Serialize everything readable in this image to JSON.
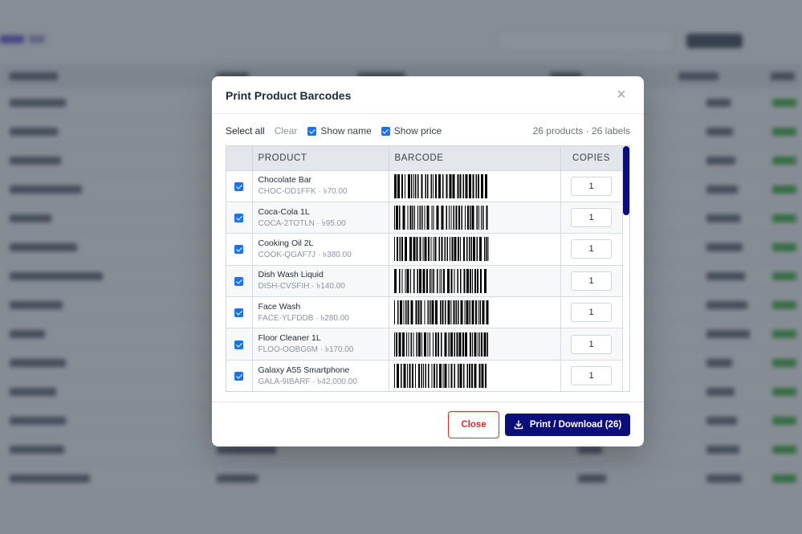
{
  "modal": {
    "title": "Print Product Barcodes",
    "close_icon": "close-icon"
  },
  "toolbar": {
    "select_all": "Select all",
    "clear": "Clear",
    "show_name": "Show name",
    "show_price": "Show price",
    "summary": "26 products · 26 labels"
  },
  "table": {
    "headers": {
      "product": "PRODUCT",
      "barcode": "BARCODE",
      "copies": "COPIES"
    },
    "rows": [
      {
        "name": "Chocolate Bar",
        "meta": "CHOC-OD1FFK · ৳70.00",
        "copies": "1",
        "checked": true
      },
      {
        "name": "Coca-Cola 1L",
        "meta": "COCA-2TOTLN · ৳95.00",
        "copies": "1",
        "checked": true
      },
      {
        "name": "Cooking Oil 2L",
        "meta": "COOK-QGAF7J · ৳380.00",
        "copies": "1",
        "checked": true
      },
      {
        "name": "Dish Wash Liquid",
        "meta": "DISH-CVSFIH · ৳140.00",
        "copies": "1",
        "checked": true
      },
      {
        "name": "Face Wash",
        "meta": "FACE-YLFDDB · ৳280.00",
        "copies": "1",
        "checked": true
      },
      {
        "name": "Floor Cleaner 1L",
        "meta": "FLOO-OOBG6M · ৳170.00",
        "copies": "1",
        "checked": true
      },
      {
        "name": "Galaxy A55 Smartphone",
        "meta": "GALA-9IBARF · ৳42,000.00",
        "copies": "1",
        "checked": true
      }
    ]
  },
  "footer": {
    "close_label": "Close",
    "print_label": "Print / Download (26)",
    "print_icon": "download-icon"
  },
  "colors": {
    "primary": "#0c0f7a",
    "danger": "#d32f2f",
    "checkbox": "#1a73e8"
  }
}
